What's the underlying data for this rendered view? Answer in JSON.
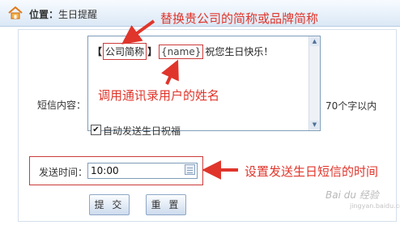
{
  "header": {
    "icon": "home-icon",
    "location_label": "位置：",
    "page_name": "生日提醒"
  },
  "form": {
    "content_label": "短信内容：",
    "sms_open_bracket": "【",
    "sms_company_placeholder": "公司简称",
    "sms_close_bracket": "】",
    "sms_name_placeholder": "{name}",
    "sms_message": "祝您生日快乐！",
    "char_limit_note": "70个字以内",
    "auto_send_checked": true,
    "auto_send_mark": "✔",
    "auto_send_label": "自动发送生日祝福",
    "send_time_label": "发送时间：",
    "send_time_value": "10:00",
    "calendar_icon": "calendar-icon"
  },
  "buttons": {
    "submit_label": "提 交",
    "reset_label": "重 置"
  },
  "annotations": {
    "company_note": "替换贵公司的简称或品牌简称",
    "name_note": "调用通讯录用户的姓名",
    "time_note": "设置发送生日短信的时间",
    "color": "#e0352b"
  },
  "watermark": {
    "main": "Bai du 经验",
    "sub": "jingyan.baidu.com"
  }
}
